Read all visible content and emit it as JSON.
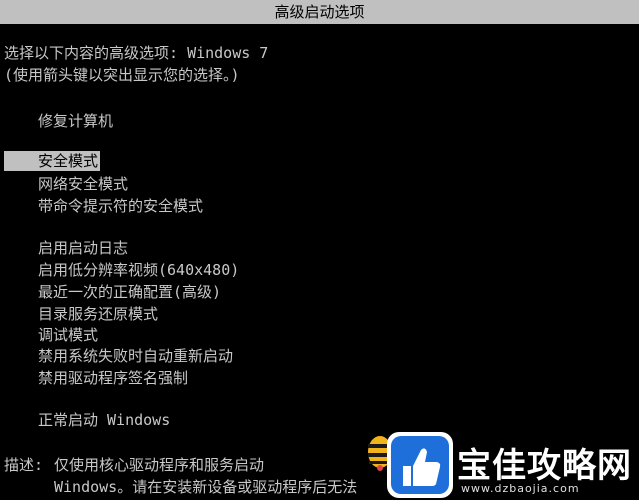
{
  "window": {
    "title": "高级启动选项"
  },
  "header": {
    "line1": "选择以下内容的高级选项: Windows 7",
    "line2": "(使用箭头键以突出显示您的选择。)"
  },
  "menu": {
    "repair": "修复计算机",
    "safe_mode": "安全模式",
    "safe_mode_networking": "网络安全模式",
    "safe_mode_cmd": "带命令提示符的安全模式",
    "boot_logging": "启用启动日志",
    "low_res_video": "启用低分辨率视频(640x480)",
    "last_known_good": "最近一次的正确配置(高级)",
    "ds_restore": "目录服务还原模式",
    "debugging": "调试模式",
    "disable_auto_restart": "禁用系统失败时自动重新启动",
    "disable_driver_sig": "禁用驱动程序签名强制",
    "start_normally": "正常启动 Windows"
  },
  "description": {
    "label": "描述:",
    "line1": "仅使用核心驱动程序和服务启动",
    "line2": "Windows。请在安装新设备或驱动程序后无法"
  },
  "watermark": {
    "brand": "宝佳攻略网",
    "url": "www.dzbaojia.com"
  },
  "colors": {
    "background": "#000000",
    "text": "#c8c8c8",
    "highlight": "#c0c0c0",
    "watermark_blue": "#1e6fd9"
  }
}
